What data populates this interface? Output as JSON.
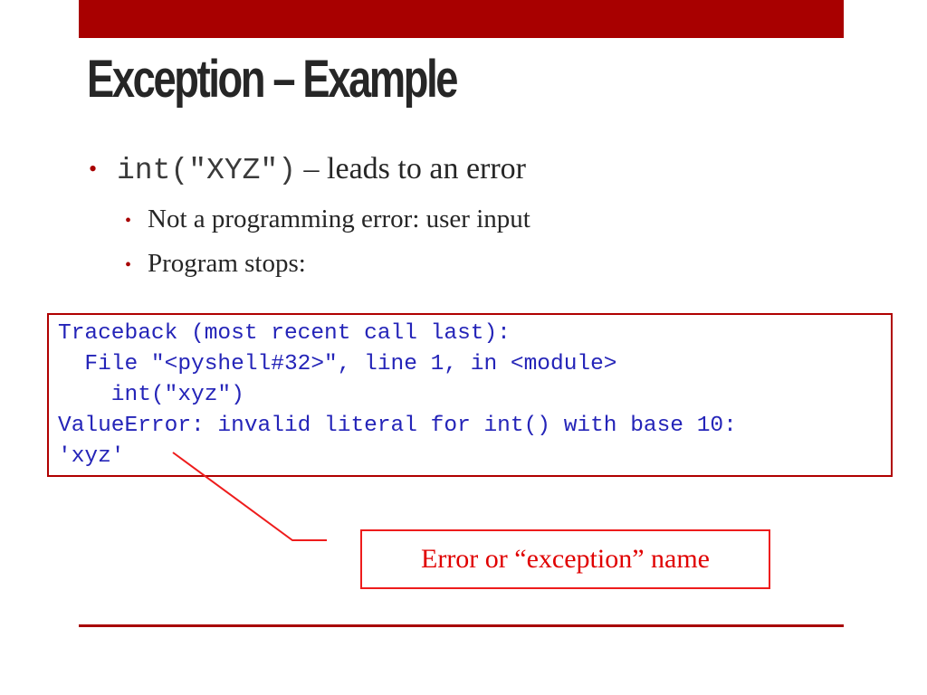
{
  "slide": {
    "title": "Exception – Example",
    "accent_color": "#a80000",
    "bullets": [
      {
        "code": "int(\"XYZ\")",
        "text": " – leads to an error",
        "sub_bullets": [
          {
            "text": "Not a programming error: user input"
          },
          {
            "text": "Program stops:"
          }
        ]
      }
    ],
    "traceback": {
      "text_color": "#2424b8",
      "lines": [
        "Traceback (most recent call last):",
        "  File \"<pyshell#32>\", line 1, in <module>",
        "    int(\"xyz\")",
        "ValueError: invalid literal for int() with base 10:",
        "'xyz'"
      ]
    },
    "callout": {
      "text": "Error or “exception” name",
      "color": "#e00000"
    },
    "bullet_glyph": "•"
  }
}
